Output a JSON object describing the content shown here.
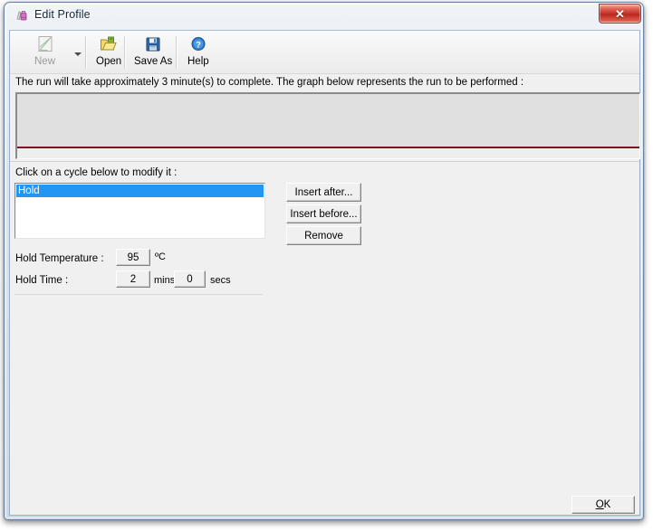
{
  "window": {
    "title": "Edit Profile",
    "title_icon": "profile-icon",
    "close_label": "✕"
  },
  "toolbar": {
    "items": [
      {
        "label": "New",
        "icon": "new-document-icon",
        "enabled": false,
        "has_dropdown": true
      },
      {
        "label": "Open",
        "icon": "open-folder-icon",
        "enabled": true,
        "has_dropdown": false
      },
      {
        "label": "Save As",
        "icon": "floppy-disk-icon",
        "enabled": true,
        "has_dropdown": false
      },
      {
        "label": "Help",
        "icon": "help-question-icon",
        "enabled": true,
        "has_dropdown": false
      }
    ]
  },
  "info": {
    "text": "The run will take approximately 3 minute(s) to complete. The graph below represents the run to be performed :"
  },
  "graph": {
    "baseline_color": "#7c1420",
    "background_color": "#e0e0e0"
  },
  "cycles": {
    "hint": "Click on a cycle below to modify it :",
    "items": [
      {
        "label": "Hold",
        "selected": true
      }
    ],
    "selection_color": "#2196f3",
    "buttons": {
      "insert_after": "Insert after...",
      "insert_before": "Insert before...",
      "remove": "Remove"
    }
  },
  "hold_settings": {
    "temperature_label": "Hold Temperature :",
    "temperature_value": "95",
    "temperature_unit": "ºC",
    "time_label": "Hold Time :",
    "minutes_value": "2",
    "minutes_unit": "mins",
    "seconds_value": "0",
    "seconds_unit": "secs"
  },
  "footer": {
    "ok_accel": "O",
    "ok_rest": "K"
  }
}
